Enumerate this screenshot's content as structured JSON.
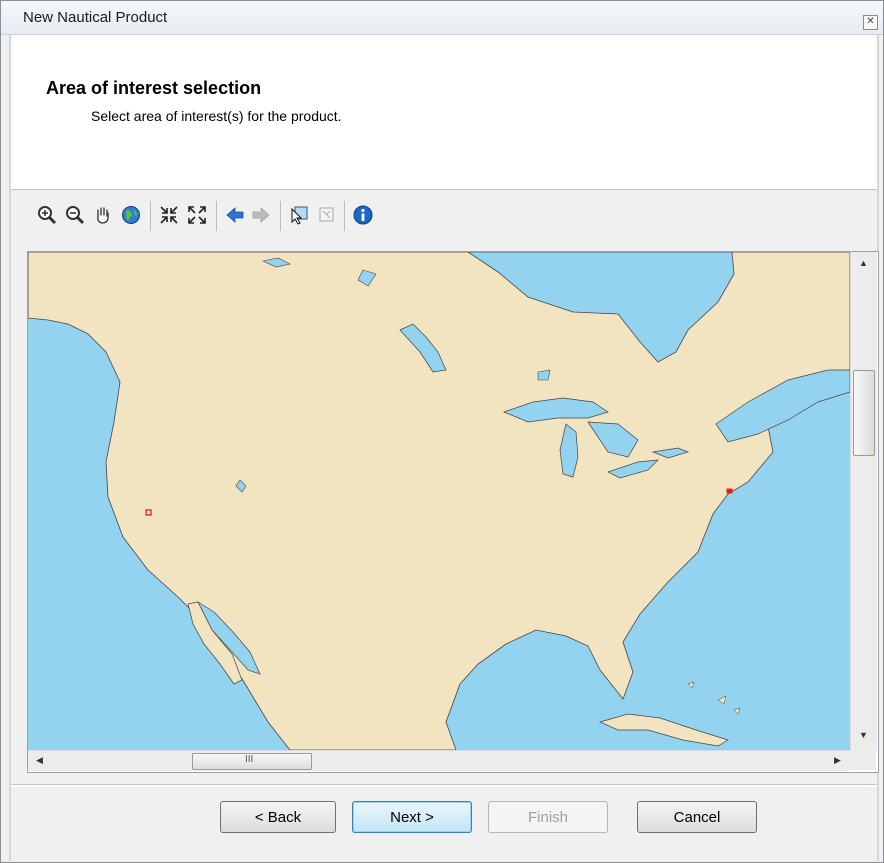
{
  "window": {
    "title": "New Nautical Product",
    "close_icon": "close-icon"
  },
  "header": {
    "title": "Area of interest selection",
    "subtitle": "Select area of interest(s) for the product."
  },
  "toolbar": {
    "tools": [
      {
        "name": "zoom-in-icon"
      },
      {
        "name": "zoom-out-icon"
      },
      {
        "name": "pan-hand-icon"
      },
      {
        "name": "full-extent-globe-icon"
      },
      {
        "name": "fixed-zoom-in-icon"
      },
      {
        "name": "fixed-zoom-out-icon"
      },
      {
        "name": "back-extent-arrow-icon"
      },
      {
        "name": "forward-extent-arrow-icon"
      },
      {
        "name": "select-features-icon"
      },
      {
        "name": "clear-selection-icon"
      },
      {
        "name": "identify-info-icon"
      }
    ]
  },
  "map": {
    "land_color": "#f2e3c1",
    "water_color": "#93d3ef",
    "aoi_color": "#e02020"
  },
  "scrollbar": {
    "h_thumb_grip": "III"
  },
  "buttons": {
    "back": "< Back",
    "next": "Next >",
    "finish": "Finish",
    "cancel": "Cancel"
  }
}
